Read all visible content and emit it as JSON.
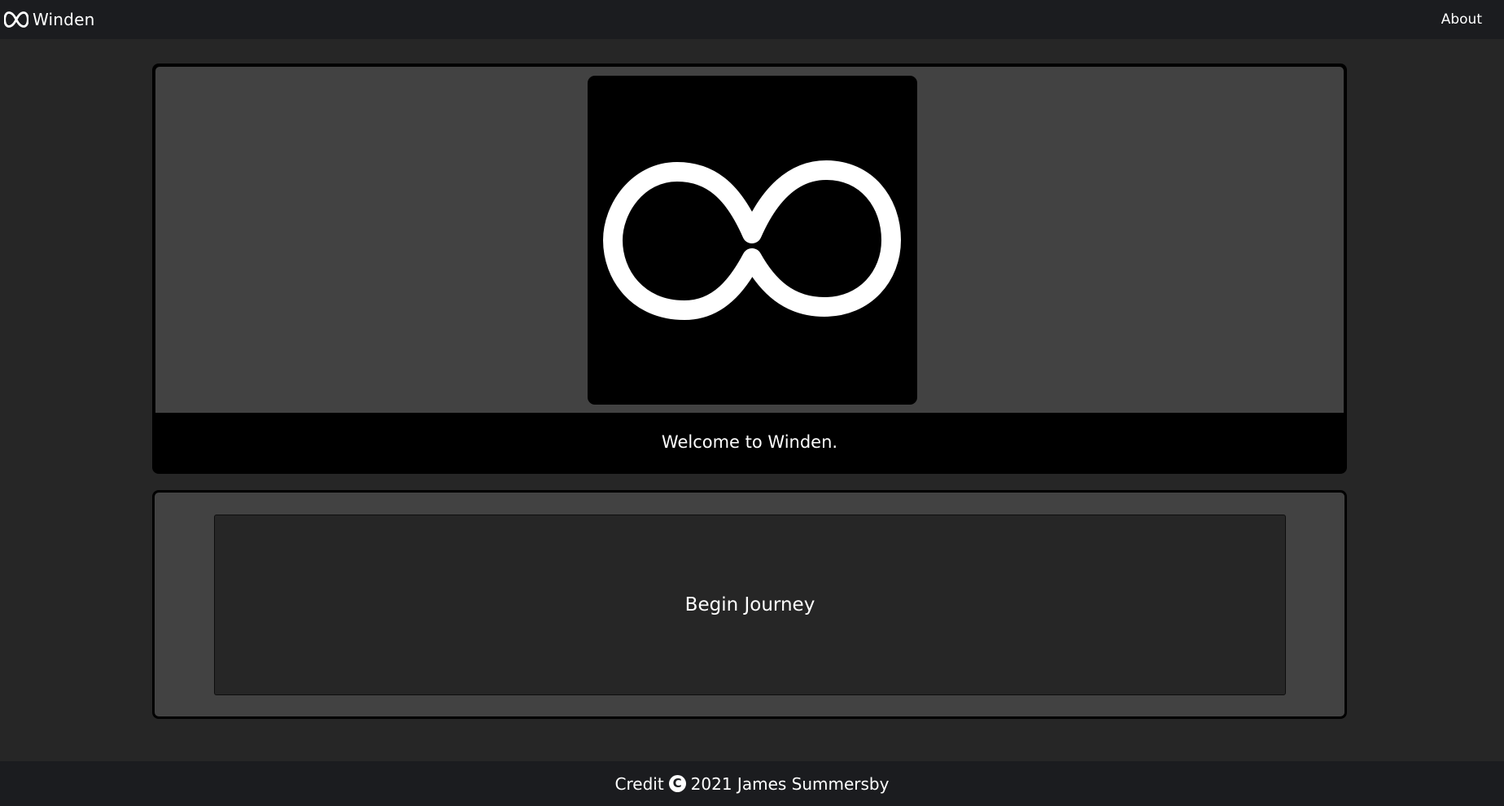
{
  "navbar": {
    "brand_icon": "infinity-icon",
    "brand_name": "Winden",
    "about_label": "About"
  },
  "hero": {
    "logo_icon": "infinity-icon",
    "welcome_text": "Welcome to Winden."
  },
  "action": {
    "begin_label": "Begin Journey"
  },
  "footer": {
    "credit_label": "Credit",
    "copyright_icon": "copyright-icon",
    "copyright_symbol": "C",
    "copyright_text": "2021 James Summersby"
  },
  "colors": {
    "page_background": "#262626",
    "navbar_background": "#1b1c1f",
    "card_background": "#424242",
    "card_border": "#000000",
    "text": "#ffffff"
  }
}
